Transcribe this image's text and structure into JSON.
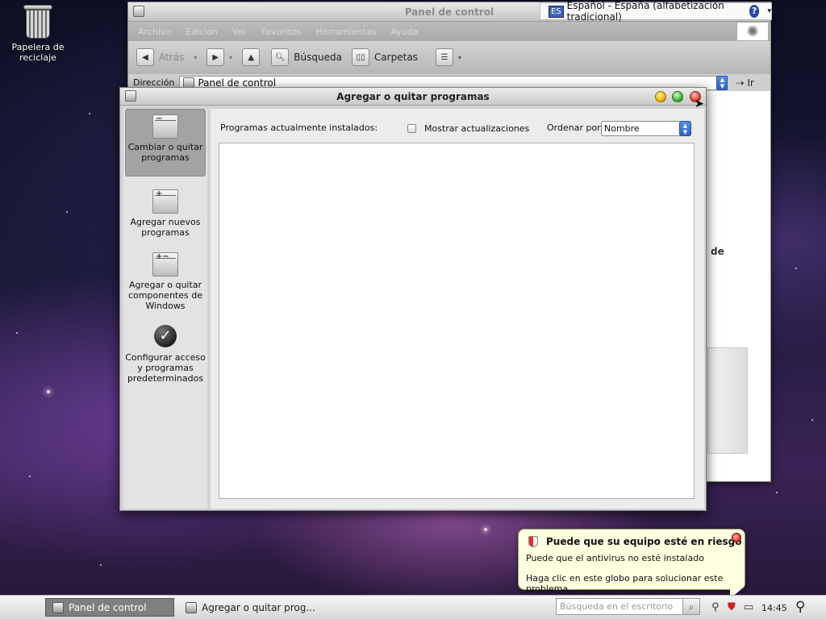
{
  "desktop": {
    "recycle_bin_label": "Papelera de reciclaje"
  },
  "control_panel": {
    "title": "Panel de control",
    "language": {
      "code": "ES",
      "name": "Español - España (alfabetización tradicional)"
    },
    "menu": [
      "Archivo",
      "Edición",
      "Ver",
      "Favoritos",
      "Herramientas",
      "Ayuda"
    ],
    "toolbar": {
      "back": "Atrás",
      "search": "Búsqueda",
      "folders": "Carpetas"
    },
    "address_label": "Dirección",
    "address_value": "Panel de control",
    "go_label": "Ir",
    "body_fragment": "de"
  },
  "add_remove": {
    "title": "Agregar o quitar programas",
    "sidebar": [
      {
        "label": "Cambiar o quitar programas",
        "active": true
      },
      {
        "label": "Agregar nuevos programas",
        "active": false
      },
      {
        "label": "Agregar o quitar componentes de Windows",
        "active": false
      },
      {
        "label": "Configurar acceso y programas predeterminados",
        "active": false
      }
    ],
    "installed_label": "Programas actualmente instalados:",
    "show_updates_label": "Mostrar actualizaciones",
    "show_updates_checked": false,
    "sort_label": "Ordenar por:",
    "sort_value": "Nombre"
  },
  "balloon": {
    "title": "Puede que su equipo esté en riesgo",
    "line1": "Puede que el antivirus no esté instalado",
    "line2": "Haga clic en este globo para solucionar este problema."
  },
  "taskbar": {
    "tasks": [
      {
        "label": "Panel de control",
        "active": true
      },
      {
        "label": "Agregar o quitar prog...",
        "active": false
      }
    ],
    "search_placeholder": "Búsqueda en el escritorio",
    "clock": "14:45"
  }
}
